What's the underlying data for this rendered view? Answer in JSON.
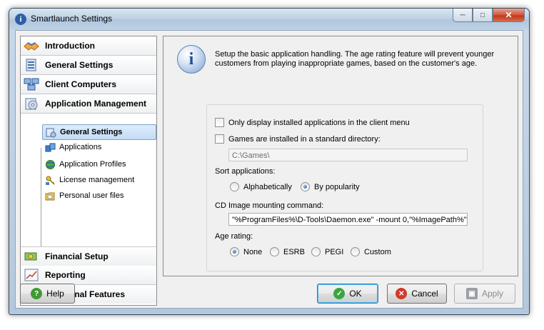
{
  "window": {
    "title": "Smartlaunch Settings"
  },
  "nav": {
    "sections_top": [
      {
        "label": "Introduction",
        "icon": "handshake-icon"
      },
      {
        "label": "General Settings",
        "icon": "settings-list-icon"
      },
      {
        "label": "Client Computers",
        "icon": "network-computers-icon"
      },
      {
        "label": "Application Management",
        "icon": "disc-icon"
      }
    ],
    "sub_items": [
      {
        "label": "General Settings",
        "icon": "app-settings-icon",
        "selected": true
      },
      {
        "label": "Applications",
        "icon": "puzzle-icon"
      },
      {
        "label": "Application Profiles",
        "icon": "globe-icon"
      },
      {
        "label": "License management",
        "icon": "keys-icon"
      },
      {
        "label": "Personal user files",
        "icon": "folder-icon"
      }
    ],
    "sections_bottom": [
      {
        "label": "Financial Setup",
        "icon": "money-icon"
      },
      {
        "label": "Reporting",
        "icon": "chart-icon"
      },
      {
        "label": "Additional Features",
        "icon": "puzzle-plus-icon"
      }
    ]
  },
  "info": {
    "text": "Setup the basic application handling.  The age rating feature will prevent younger customers from playing inappropriate games, based on the customer's age."
  },
  "form": {
    "only_installed_label": "Only display installed applications in the client menu",
    "only_installed_checked": false,
    "standard_dir_label": "Games are installed in a standard directory:",
    "standard_dir_checked": false,
    "standard_dir_value": "C:\\Games\\",
    "sort_label": "Sort applications:",
    "sort_options": [
      "Alphabetically",
      "By popularity"
    ],
    "sort_selected": "By popularity",
    "cd_label": "CD Image mounting command:",
    "cd_value": "\"%ProgramFiles%\\D-Tools\\Daemon.exe\" -mount 0,\"%ImagePath%\"",
    "age_label": "Age rating:",
    "age_options": [
      "None",
      "ESRB",
      "PEGI",
      "Custom"
    ],
    "age_selected": "None"
  },
  "buttons": {
    "help": "Help",
    "ok": "OK",
    "cancel": "Cancel",
    "apply": "Apply"
  },
  "colors": {
    "accent": "#3c7fb1",
    "selection": "#c4dcf6",
    "close_button": "#c23718"
  }
}
